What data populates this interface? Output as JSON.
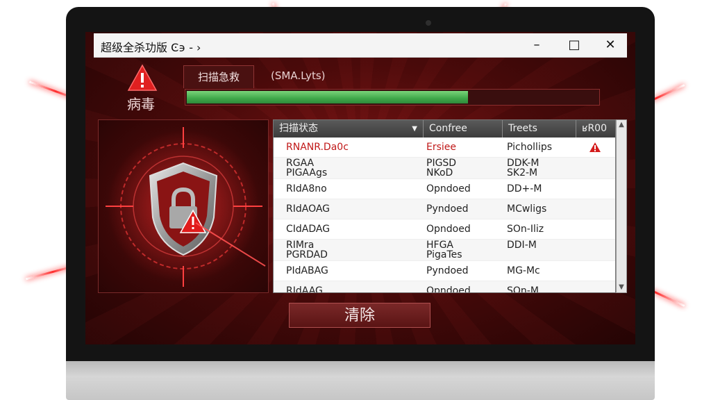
{
  "window": {
    "title": "超级全杀功版 Ͼ϶ - ›",
    "min_label": "–",
    "max_label": "□",
    "close_label": "✕"
  },
  "alert": {
    "label": "病毒"
  },
  "tabs": [
    {
      "label": "扫描急救"
    },
    {
      "label": "(SMA.Lyts)"
    }
  ],
  "progress": {
    "value": 0.68
  },
  "table": {
    "columns": [
      "扫描状态",
      "Confree",
      "Treets",
      "ʁR00"
    ],
    "rows": [
      {
        "c1": "RNANR.Da0c",
        "c2": "Ersiee",
        "c3": "Pichollips",
        "alert": true
      },
      {
        "c1": "RGAA\nPIGAAgs",
        "c2": "PIGSD\nNKoD",
        "c3": "DDK-M\nSK2-M",
        "alert": false
      },
      {
        "c1": "RIdA8no",
        "c2": "Opndoed",
        "c3": "DD+-M",
        "alert": false
      },
      {
        "c1": "RIdAOAG",
        "c2": "Pyndoed",
        "c3": "MCwligs",
        "alert": false
      },
      {
        "c1": "CIdADAG",
        "c2": "Opndoed",
        "c3": "SOn-Iliz",
        "alert": false
      },
      {
        "c1": "RIMra\nPGRDAD",
        "c2": "HFGA\nPigaTes",
        "c3": "DDI-M",
        "alert": false
      },
      {
        "c1": "PIdABAG",
        "c2": "Pyndoed",
        "c3": "MG-Mc",
        "alert": false
      },
      {
        "c1": "RIdAAG",
        "c2": "Opndoed",
        "c3": "SOn-M",
        "alert": false
      }
    ]
  },
  "actions": {
    "clear_label": "清除"
  },
  "colors": {
    "accent": "#c01818",
    "progress": "#3fa84a",
    "background": "#4a0a0a"
  }
}
